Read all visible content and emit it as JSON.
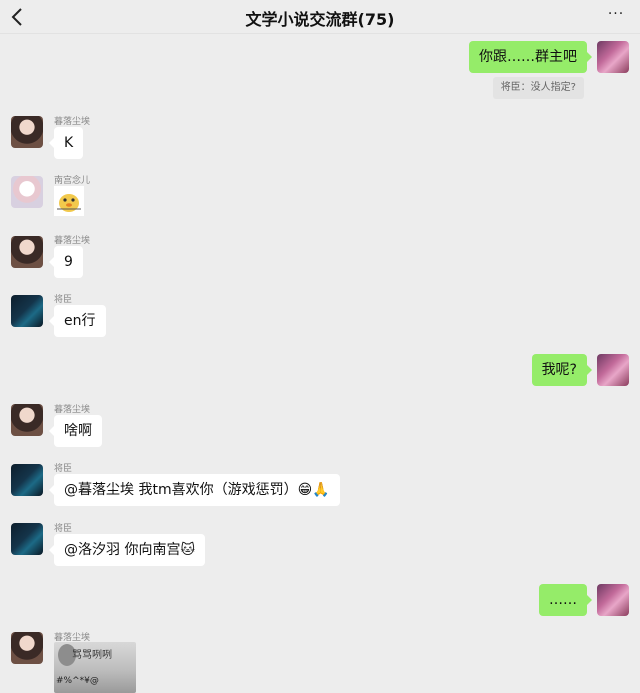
{
  "header": {
    "title": "文学小说交流群(75)",
    "more_label": "···"
  },
  "messages": [
    {
      "from": "me",
      "text": "你跟……群主吧",
      "quote": "将臣：没人指定?"
    },
    {
      "sender": "暮落尘埃",
      "text": "K"
    },
    {
      "sender": "南宫念儿",
      "sticker": "duck-sticker"
    },
    {
      "sender": "暮落尘埃",
      "text": "9"
    },
    {
      "sender": "将臣",
      "text": "en行"
    },
    {
      "from": "me",
      "text": "我呢?"
    },
    {
      "sender": "暮落尘埃",
      "text": "啥啊"
    },
    {
      "sender": "将臣",
      "text": "@暮落尘埃 我tm喜欢你（游戏惩罚）😁🙏"
    },
    {
      "sender": "将臣",
      "text": "@洛汐羽 你向南宫🐱"
    },
    {
      "from": "me",
      "text": "……"
    },
    {
      "sender": "暮落尘埃",
      "image_text_top": "骂骂咧咧",
      "image_text_bottom": "#%^*¥@"
    }
  ]
}
